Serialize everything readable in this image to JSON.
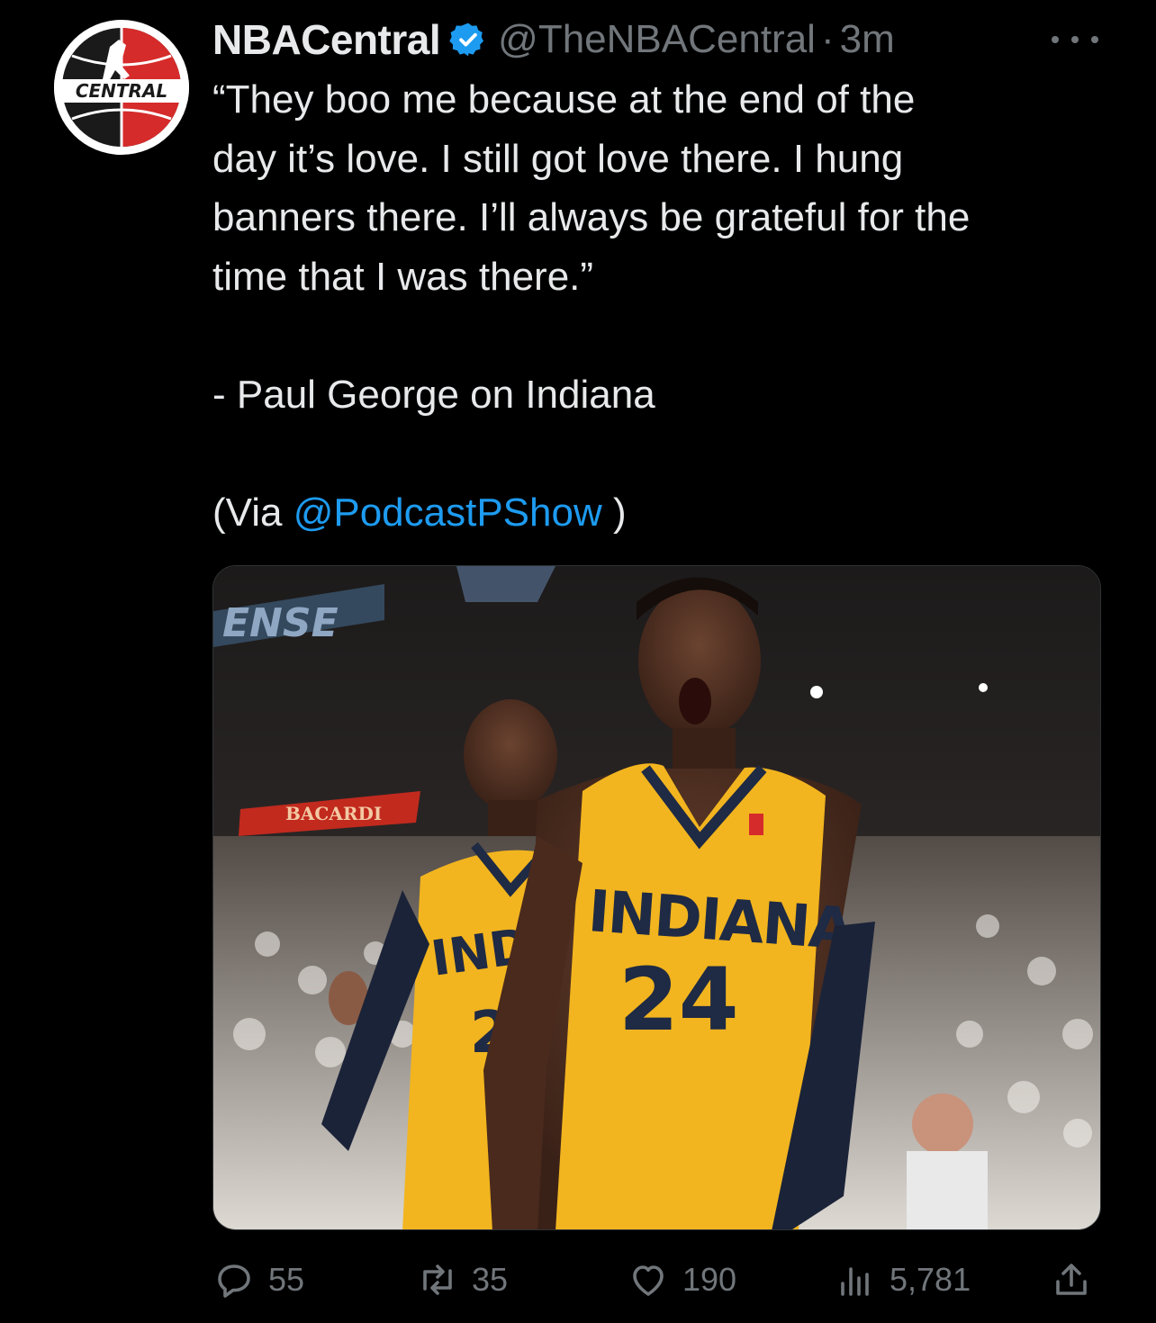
{
  "tweet": {
    "author_name": "NBACentral",
    "handle": "@TheNBACentral",
    "separator": "·",
    "time": "3m",
    "avatar_text": "CENTRAL",
    "quote_lines": [
      "“They boo me because at the end of the",
      "day it’s love. I still got love there. I hung",
      "banners there. I’ll always be grateful for the",
      "time that I was there.”"
    ],
    "attribution": "- Paul George on Indiana",
    "via_prefix": "(Via ",
    "via_mention": "@PodcastPShow",
    "via_suffix": " )"
  },
  "media": {
    "jersey_front": "INDIANA",
    "jersey_number": "24",
    "jersey_back_partial": "INDI",
    "jersey_back_number": "2",
    "arena_sign": "ENSE",
    "arena_ad": "BACARDI"
  },
  "actions": {
    "replies": "55",
    "retweets": "35",
    "likes": "190",
    "views": "5,781"
  },
  "colors": {
    "background": "#000000",
    "text": "#e7e9ea",
    "secondary": "#71767b",
    "link": "#1d9bf0",
    "verified": "#1d9bf0",
    "jersey_gold": "#f2b51f"
  },
  "icons": [
    "more-icon",
    "verified-icon",
    "reply-icon",
    "retweet-icon",
    "like-icon",
    "views-icon",
    "share-icon"
  ]
}
